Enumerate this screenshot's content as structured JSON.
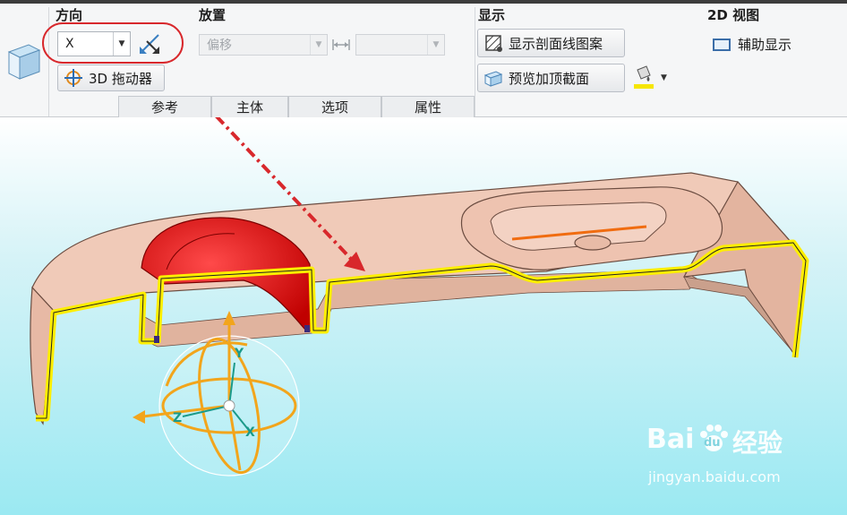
{
  "ribbon": {
    "groups": {
      "direction": "方向",
      "placement": "放置",
      "display": "显示",
      "view2d": "2D 视图"
    },
    "direction_combo_value": "X",
    "drag_button_label": "3D 拖动器",
    "offset_combo_value": "偏移",
    "show_hatch_label": "显示剖面线图案",
    "preview_cap_label": "预览加顶截面",
    "aux_display_label": "辅助显示",
    "tabs": [
      "参考",
      "主体",
      "选项",
      "属性"
    ]
  },
  "watermark": {
    "brand": "Bai",
    "brand2": "du",
    "brand_cn": "经验",
    "url": "jingyan.baidu.com"
  },
  "gizmo_axes": [
    "Y",
    "Z",
    "X"
  ],
  "colors": {
    "annotation_red": "#d8282c",
    "section_yellow": "#ffee00",
    "model_skin": "#f0c8b4",
    "gizmo_orange": "#f2a51c"
  }
}
